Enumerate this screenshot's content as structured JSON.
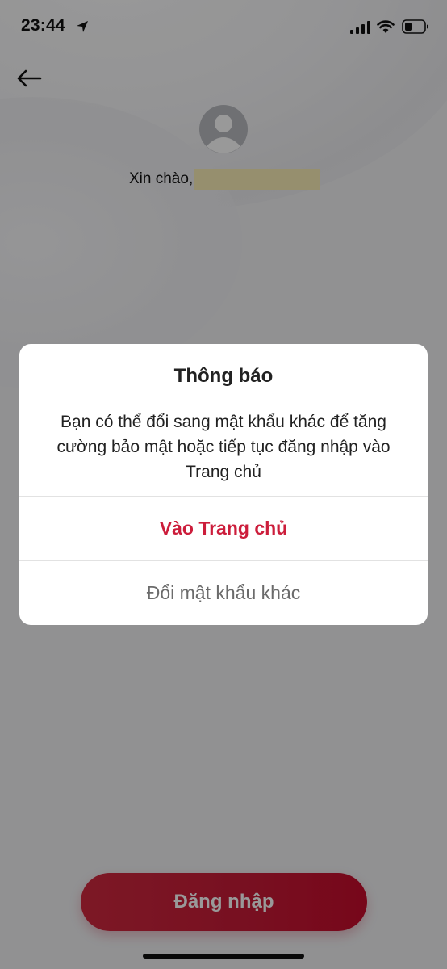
{
  "status_bar": {
    "time": "23:44",
    "icons": [
      "location-arrow-icon",
      "cellular-signal-icon",
      "wifi-icon",
      "battery-icon"
    ]
  },
  "header": {
    "back_icon": "arrow-left-icon",
    "avatar_icon": "user-avatar-icon",
    "greeting": "Xin chào,"
  },
  "dialog": {
    "title": "Thông báo",
    "message": "Bạn có thể đổi sang mật khẩu khác để tăng cường bảo mật hoặc tiếp tục đăng nhập vào Trang chủ",
    "primary_action": "Vào Trang chủ",
    "secondary_action": "Đổi mật khẩu khác"
  },
  "login_button": "Đăng nhập",
  "colors": {
    "accent": "#cc1d3b",
    "highlight": "#fbeeb8",
    "overlay": "rgba(0,0,0,0.4)"
  }
}
